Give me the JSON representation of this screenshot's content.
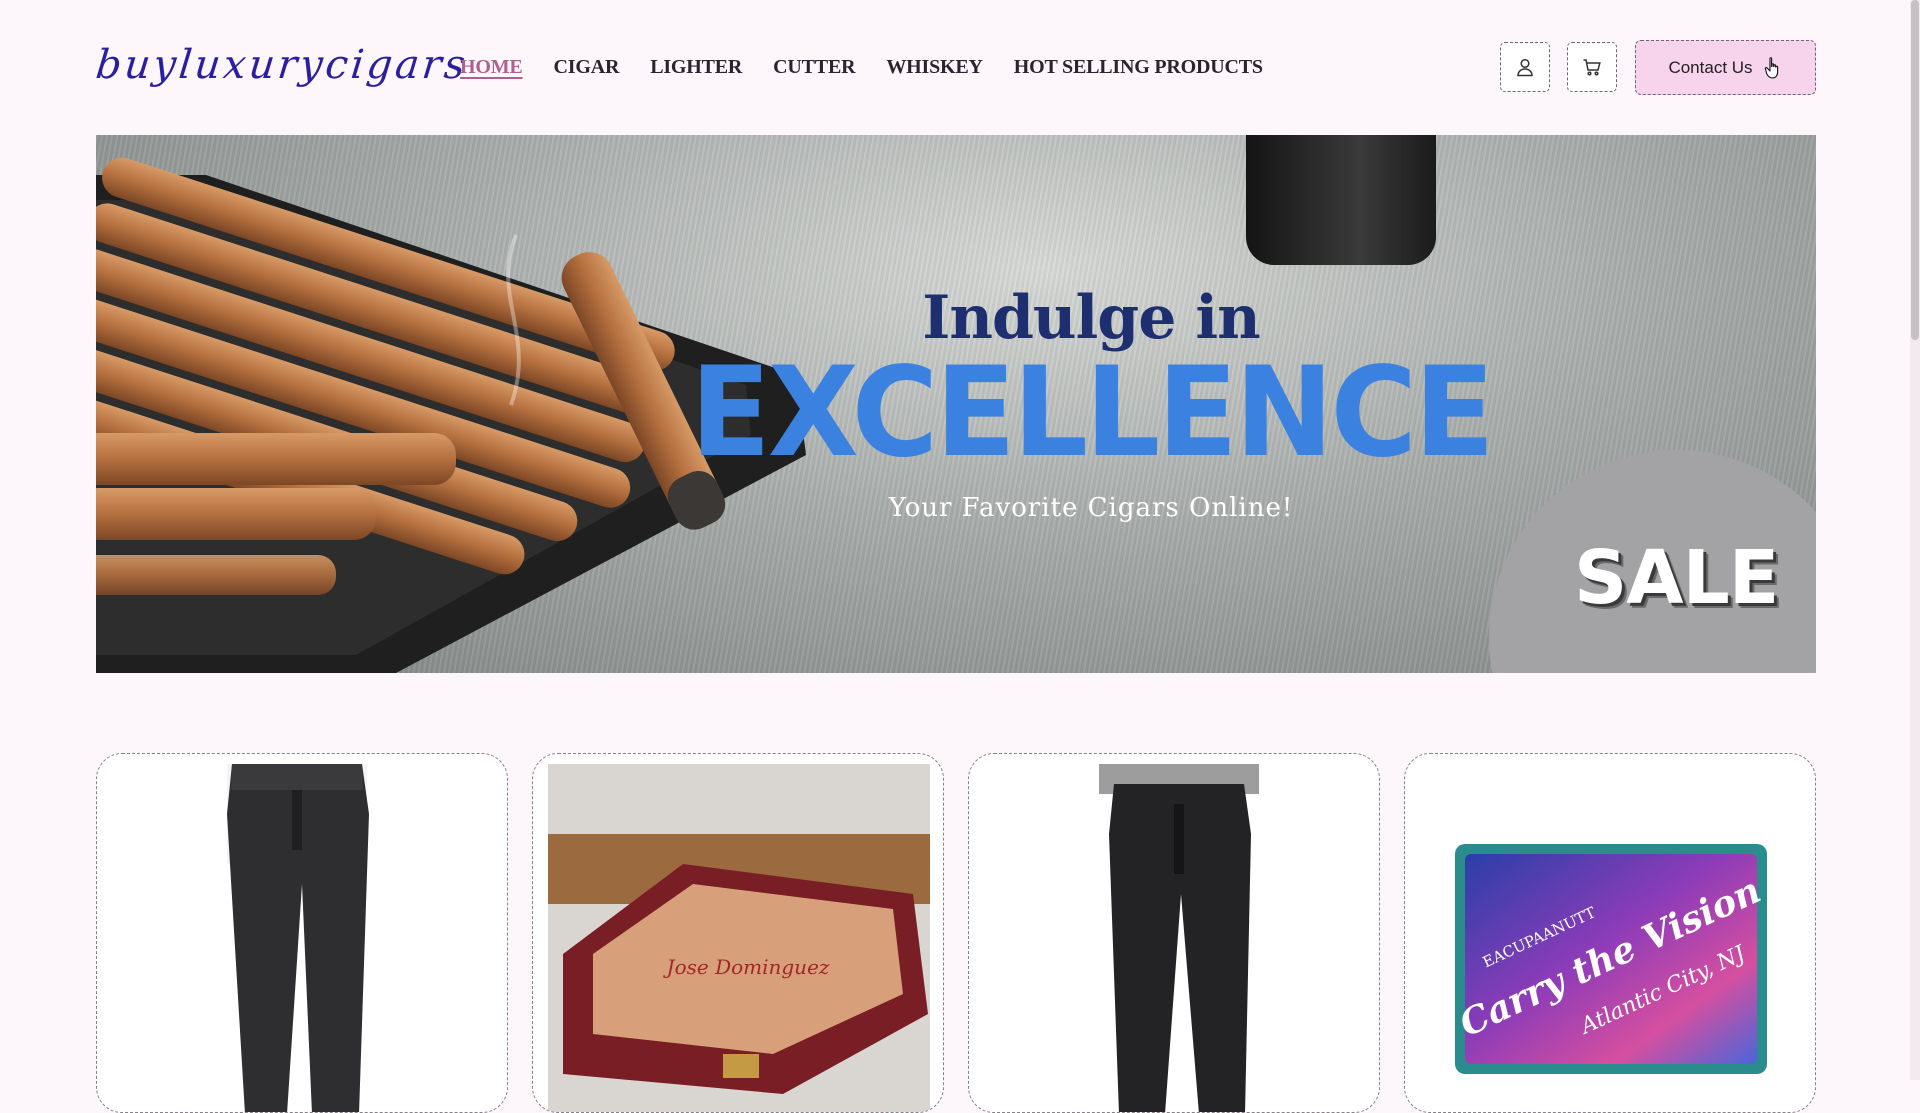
{
  "header": {
    "logo_text": "buyluxurycigars",
    "nav": [
      {
        "label": "HOME",
        "active": true
      },
      {
        "label": "CIGAR",
        "active": false
      },
      {
        "label": "LIGHTER",
        "active": false
      },
      {
        "label": "CUTTER",
        "active": false
      },
      {
        "label": "WHISKEY",
        "active": false
      },
      {
        "label": "HOT SELLING PRODUCTS",
        "active": false
      }
    ],
    "account_icon": "user-icon",
    "cart_icon": "cart-icon",
    "contact_label": "Contact Us",
    "contact_icon": "pointer-hand-icon"
  },
  "hero": {
    "line1": "Indulge in",
    "line2": "EXCELLENCE",
    "tagline": "Your Favorite Cigars Online!",
    "badge": "SALE"
  },
  "products": [
    {
      "image": "black-jeans-photo"
    },
    {
      "image": "wooden-humidor-box-photo",
      "box_text": "Jose Dominguez"
    },
    {
      "image": "black-jeans-photo"
    },
    {
      "image": "embroidered-patch-photo",
      "patch_lines": [
        "EACUPAANUTT",
        "Carry the Vision",
        "Atlantic City, NJ"
      ]
    }
  ],
  "colors": {
    "accent": "#b0608e",
    "contact_bg": "#f7d3ec",
    "headline_blue": "#3b82e0",
    "headline_navy": "#1d2f6f",
    "page_bg": "#fdf6fa"
  }
}
